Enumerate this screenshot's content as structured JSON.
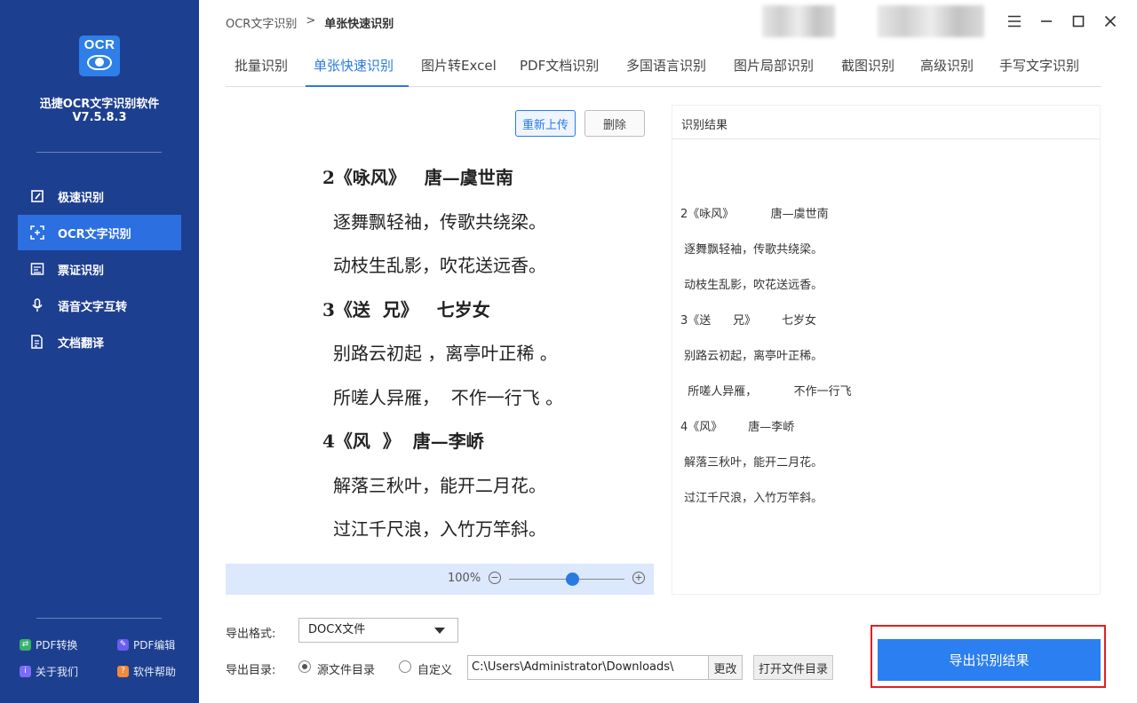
{
  "sidebar": {
    "logo_text": "OCR",
    "app_name": "迅捷OCR文字识别软件",
    "version": "V7.5.8.3",
    "nav": [
      {
        "label": "极速识别",
        "icon": "fast-scan-icon"
      },
      {
        "label": "OCR文字识别",
        "icon": "scan-frame-icon"
      },
      {
        "label": "票证识别",
        "icon": "id-card-icon"
      },
      {
        "label": "语音文字互转",
        "icon": "microphone-icon"
      },
      {
        "label": "文档翻译",
        "icon": "document-translate-icon"
      }
    ],
    "active_nav": "OCR文字识别",
    "footer": {
      "pdf_convert": "PDF转换",
      "pdf_edit": "PDF编辑",
      "about": "关于我们",
      "help": "软件帮助"
    }
  },
  "header": {
    "breadcrumb_root": "OCR文字识别",
    "breadcrumb_sep": ">",
    "breadcrumb_current": "单张快速识别"
  },
  "tabs": [
    "批量识别",
    "单张快速识别",
    "图片转Excel",
    "PDF文档识别",
    "多国语言识别",
    "图片局部识别",
    "截图识别",
    "高级识别",
    "手写文字识别"
  ],
  "active_tab": "单张快速识别",
  "image_panel": {
    "reupload_label": "重新上传",
    "delete_label": "删除",
    "zoom_label": "100%",
    "zoom_level": 0.55,
    "lines": [
      "2《咏风》   唐—虞世南",
      "逐舞飘轻袖，传歌共绕梁。",
      "动枝生乱影，吹花送远香。",
      "3《送  兄》   七岁女",
      "别路云初起 ，离亭叶正稀 。",
      "所嗟人异雁，  不作一行飞 。",
      "4《风  》  唐—李峤",
      "解落三秋叶，能开二月花。",
      "过江千尺浪，入竹万竿斜。"
    ]
  },
  "result_panel": {
    "title": "识别结果",
    "lines": [
      "2《咏风》          唐—虞世南",
      " 逐舞飘轻袖，传歌共绕梁。",
      " 动枝生乱影，吹花送远香。",
      "3《送      兄》       七岁女",
      " 别路云初起，离亭叶正稀。",
      "  所嗟人异雁，          不作一行飞",
      "4《风》       唐—李峤",
      " 解落三秋叶，能开二月花。",
      " 过江千尺浪，入竹万竿斜。"
    ]
  },
  "export": {
    "format_label": "导出格式:",
    "format_value": "DOCX文件",
    "dir_label": "导出目录:",
    "source_dir_label": "源文件目录",
    "custom_label": "自定义",
    "path_value": "C:\\Users\\Administrator\\Downloads\\",
    "change_label": "更改",
    "open_folder_label": "打开文件目录",
    "export_button_label": "导出识别结果"
  },
  "colors": {
    "sidebar_bg": "#1d3f8f",
    "accent": "#2a7ae2",
    "highlight_border": "#e02020"
  }
}
